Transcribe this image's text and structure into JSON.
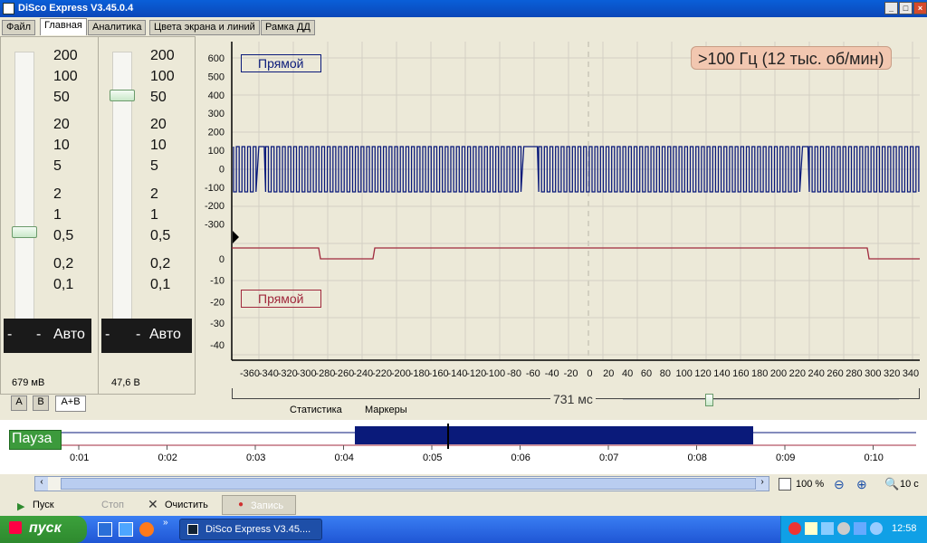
{
  "window": {
    "title": "DiSco Express V3.45.0.4"
  },
  "menu": {
    "tabs": [
      "Файл",
      "Главная",
      "Аналитика",
      "Цвета экрана и линий",
      "Рамка ДД"
    ]
  },
  "left_panel": {
    "scale_labels": [
      "200",
      "100",
      "50",
      "20",
      "10",
      "5",
      "2",
      "1",
      "0,5",
      "0,2",
      "0,1"
    ],
    "auto_label": "Авто",
    "dash_label": "-",
    "channel_a_value": "679 мВ",
    "channel_b_value": "47,6 В",
    "tabs": [
      "A",
      "B",
      "A+B"
    ]
  },
  "chart": {
    "badge": ">100 Гц (12 тыс. об/мин)",
    "channel_a_label": "Прямой",
    "channel_b_label": "Прямой",
    "upper_y_ticks": [
      "600",
      "500",
      "400",
      "300",
      "200",
      "100",
      "0",
      "-100",
      "-200",
      "-300"
    ],
    "lower_y_ticks": [
      "0",
      "-10",
      "-20",
      "-30",
      "-40"
    ],
    "x_ticks": [
      "-360",
      "-340",
      "-320",
      "-300",
      "-280",
      "-260",
      "-240",
      "-220",
      "-200",
      "-180",
      "-160",
      "-140",
      "-120",
      "-100",
      "-80",
      "-60",
      "-40",
      "-20",
      "0",
      "20",
      "40",
      "60",
      "80",
      "100",
      "120",
      "140",
      "160",
      "180",
      "200",
      "220",
      "240",
      "260",
      "280",
      "300",
      "320",
      "340"
    ],
    "timespan_label": "731 мс",
    "bottom_tabs": [
      "Статистика",
      "Маркеры"
    ],
    "colors": {
      "channel_a": "#0a1a7a",
      "channel_b": "#a0283c",
      "badge_bg": "#f2c7b0"
    }
  },
  "timeline": {
    "status": "Пауза",
    "ticks": [
      "0:01",
      "0:02",
      "0:03",
      "0:04",
      "0:05",
      "0:06",
      "0:07",
      "0:08",
      "0:09",
      "0:10"
    ]
  },
  "zoom": {
    "percent": "100 %",
    "seconds": "10 с"
  },
  "controls": {
    "start": "Пуск",
    "stop": "Стоп",
    "clear": "Очистить",
    "record": "Запись"
  },
  "taskbar": {
    "start_label": "пуск",
    "task_label": "DiSco Express V3.45....",
    "clock": "12:58"
  }
}
